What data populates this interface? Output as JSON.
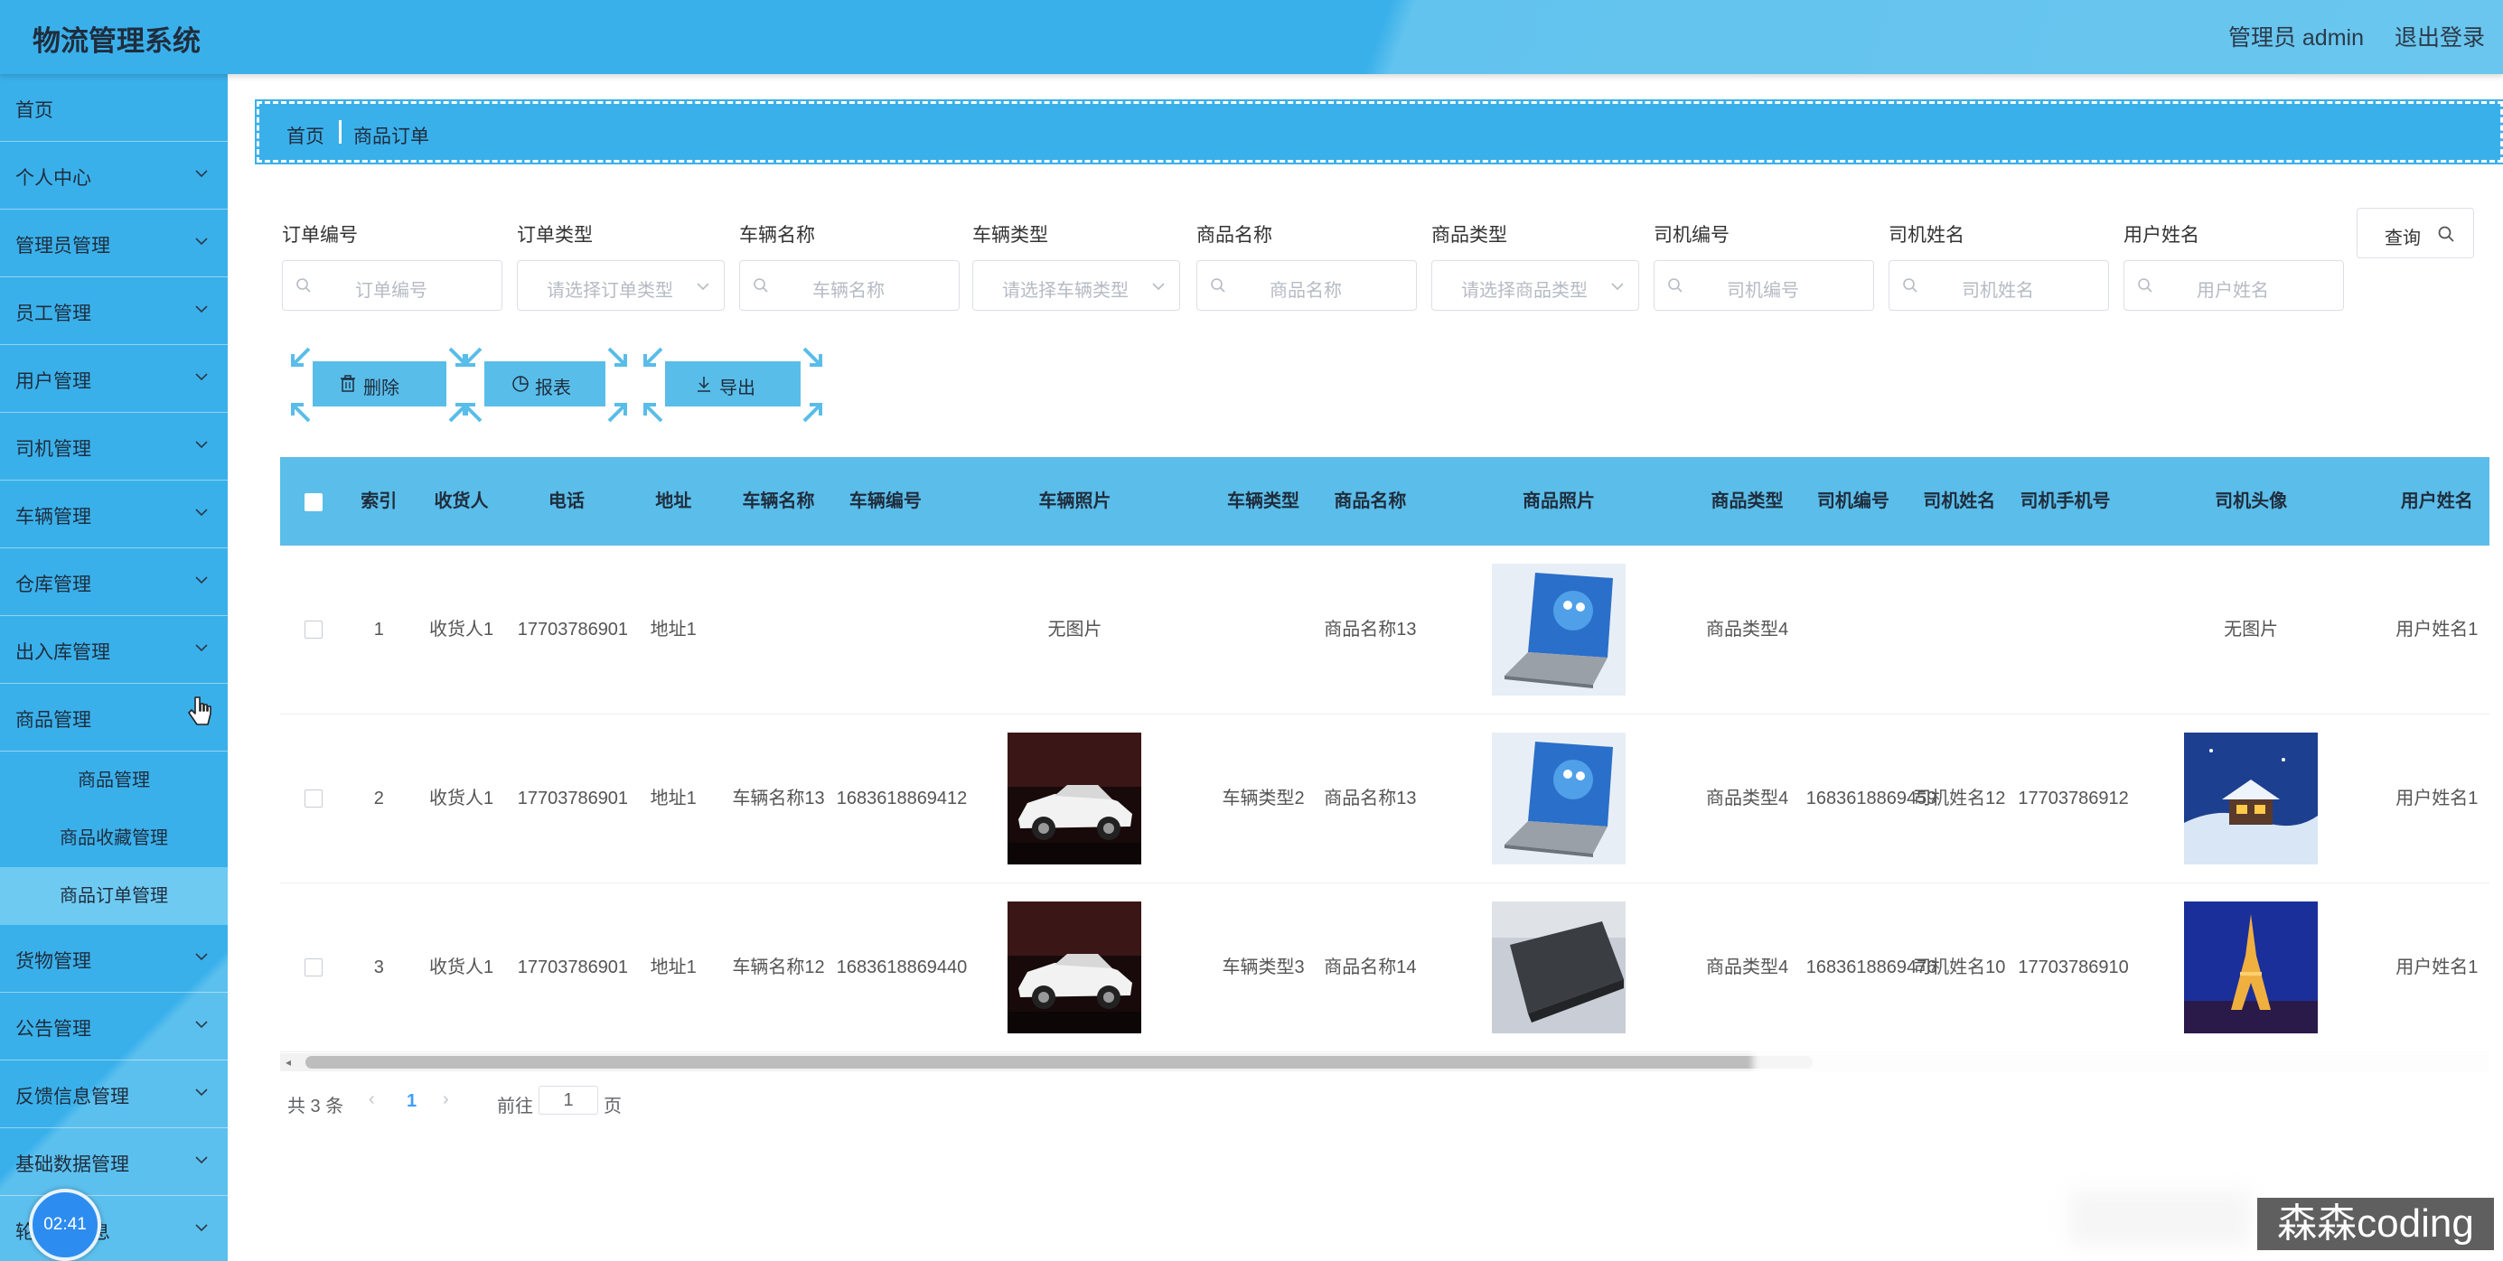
{
  "header": {
    "app_title": "物流管理系统",
    "user_label": "管理员 admin",
    "logout_label": "退出登录"
  },
  "sidebar": {
    "home": "首页",
    "items": [
      {
        "label": "个人中心"
      },
      {
        "label": "管理员管理"
      },
      {
        "label": "员工管理"
      },
      {
        "label": "用户管理"
      },
      {
        "label": "司机管理"
      },
      {
        "label": "车辆管理"
      },
      {
        "label": "仓库管理"
      },
      {
        "label": "出入库管理"
      },
      {
        "label": "商品管理"
      }
    ],
    "sub_items": [
      {
        "label": "商品管理"
      },
      {
        "label": "商品收藏管理"
      },
      {
        "label": "商品订单管理"
      }
    ],
    "items_after": [
      {
        "label": "货物管理"
      },
      {
        "label": "公告管理"
      },
      {
        "label": "反馈信息管理"
      },
      {
        "label": "基础数据管理"
      },
      {
        "label": "轮播图信息"
      }
    ]
  },
  "timer": "02:41",
  "breadcrumb": {
    "home": "首页",
    "current": "商品订单"
  },
  "filters": [
    {
      "label": "订单编号",
      "placeholder": "订单编号",
      "type": "input"
    },
    {
      "label": "订单类型",
      "placeholder": "请选择订单类型",
      "type": "select"
    },
    {
      "label": "车辆名称",
      "placeholder": "车辆名称",
      "type": "input"
    },
    {
      "label": "车辆类型",
      "placeholder": "请选择车辆类型",
      "type": "select"
    },
    {
      "label": "商品名称",
      "placeholder": "商品名称",
      "type": "input"
    },
    {
      "label": "商品类型",
      "placeholder": "请选择商品类型",
      "type": "select"
    },
    {
      "label": "司机编号",
      "placeholder": "司机编号",
      "type": "input"
    },
    {
      "label": "司机姓名",
      "placeholder": "司机姓名",
      "type": "input"
    },
    {
      "label": "用户姓名",
      "placeholder": "用户姓名",
      "type": "input"
    }
  ],
  "query_label": "查询",
  "actions": {
    "delete": "删除",
    "report": "报表",
    "export": "导出"
  },
  "table": {
    "columns": [
      "索引",
      "收货人",
      "电话",
      "地址",
      "车辆名称",
      "车辆编号",
      "车辆照片",
      "车辆类型",
      "商品名称",
      "商品照片",
      "商品类型",
      "司机编号",
      "司机姓名",
      "司机手机号",
      "司机头像",
      "用户姓名"
    ],
    "rows": [
      {
        "index": "1",
        "receiver": "收货人1",
        "phone": "17703786901",
        "address": "地址1",
        "vehicle_name": "",
        "vehicle_no": "",
        "vehicle_photo": "无图片",
        "vehicle_type": "",
        "goods_name": "商品名称13",
        "goods_photo": "laptop-blue",
        "goods_type": "商品类型4",
        "driver_no": "",
        "driver_name": "",
        "driver_phone": "",
        "driver_avatar": "无图片",
        "user_name": "用户姓名1"
      },
      {
        "index": "2",
        "receiver": "收货人1",
        "phone": "17703786901",
        "address": "地址1",
        "vehicle_name": "车辆名称13",
        "vehicle_no": "1683618869412",
        "vehicle_photo": "car",
        "vehicle_type": "车辆类型2",
        "goods_name": "商品名称13",
        "goods_photo": "laptop-blue",
        "goods_type": "商品类型4",
        "driver_no": "1683618869459",
        "driver_name": "司机姓名12",
        "driver_phone": "17703786912",
        "driver_avatar": "snow-house",
        "user_name": "用户姓名1"
      },
      {
        "index": "3",
        "receiver": "收货人1",
        "phone": "17703786901",
        "address": "地址1",
        "vehicle_name": "车辆名称12",
        "vehicle_no": "1683618869440",
        "vehicle_photo": "car",
        "vehicle_type": "车辆类型3",
        "goods_name": "商品名称14",
        "goods_photo": "laptop-dark",
        "goods_type": "商品类型4",
        "driver_no": "1683618869476",
        "driver_name": "司机姓名10",
        "driver_phone": "17703786910",
        "driver_avatar": "eiffel-tower",
        "user_name": "用户姓名1"
      }
    ]
  },
  "pagination": {
    "total": "共 3 条",
    "current_page": "1",
    "goto_label": "前往",
    "goto_value": "1",
    "page_unit": "页"
  },
  "watermark": "森森coding"
}
